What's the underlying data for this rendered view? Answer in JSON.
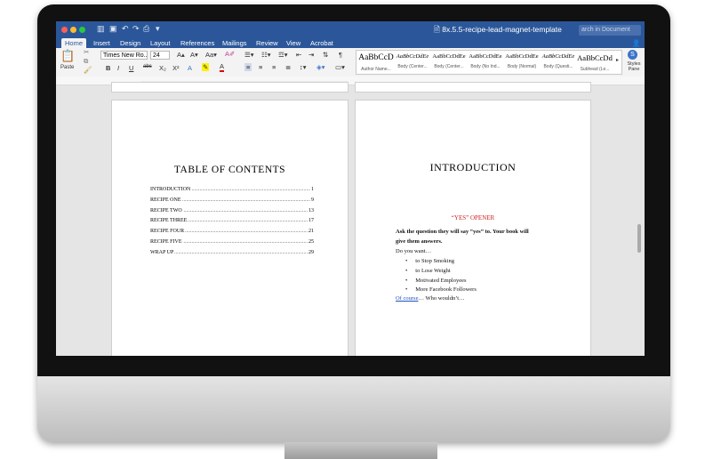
{
  "window": {
    "title": "8x.5.5-recipe-lead-magnet-template",
    "search_placeholder": "arch in Document",
    "traffic_lights": [
      "#ff5f57",
      "#febc2e",
      "#28c840"
    ]
  },
  "ribbon_tabs": [
    "Home",
    "Insert",
    "Design",
    "Layout",
    "References",
    "Mailings",
    "Review",
    "View",
    "Acrobat"
  ],
  "home": {
    "paste_label": "Paste",
    "font_name": "Times New Ro...",
    "font_size": "24",
    "grow_font": "A▴",
    "shrink_font": "A▾",
    "bold": "B",
    "italic": "I",
    "underline": "U",
    "strikethrough": "abc",
    "subscript": "X₂",
    "superscript": "X²",
    "styles_pane_label": "Styles Pane",
    "styles": [
      {
        "sample": "AaBbCcD",
        "name": "Author Name..."
      },
      {
        "sample": "AaBbCcDdEe",
        "name": "Body (Center..."
      },
      {
        "sample": "AaBbCcDdEe",
        "name": "Body (Center..."
      },
      {
        "sample": "AaBbCcDdEe",
        "name": "Body (No Ind..."
      },
      {
        "sample": "AaBbCcDdEe",
        "name": "Body (Normal)"
      },
      {
        "sample": "AaBbCcDdEe",
        "name": "Body (Questi..."
      },
      {
        "sample": "AaBbCcDd",
        "name": "Subhead (Le..."
      }
    ]
  },
  "colors": {
    "word_blue": "#2b579a",
    "accent_red": "#cc2222",
    "link_blue": "#1f4fbf"
  },
  "toc": {
    "title": "TABLE OF CONTENTS",
    "entries": [
      {
        "label": "INTRODUCTION",
        "page": "1"
      },
      {
        "label": "RECIPE ONE",
        "page": "9"
      },
      {
        "label": "RECIPE TWO",
        "page": "13"
      },
      {
        "label": "RECIPE THREE",
        "page": "17"
      },
      {
        "label": "RECIPE FOUR",
        "page": "21"
      },
      {
        "label": "RECIPE FIVE",
        "page": "25"
      },
      {
        "label": "WRAP UP",
        "page": "29"
      }
    ]
  },
  "intro": {
    "title": "INTRODUCTION",
    "subtitle": "“YES” OPENER",
    "line1": "Ask the question they will say “yes” to.  Your book will",
    "line2": "give them answers.",
    "line3": "Do you want…",
    "bullets": [
      "to Stop Smoking",
      "to Lose Weight",
      "Motivated Employees",
      "More Facebook Followers"
    ],
    "closing_link": "Of course",
    "closing_rest": "…  Who wouldn’t…"
  }
}
